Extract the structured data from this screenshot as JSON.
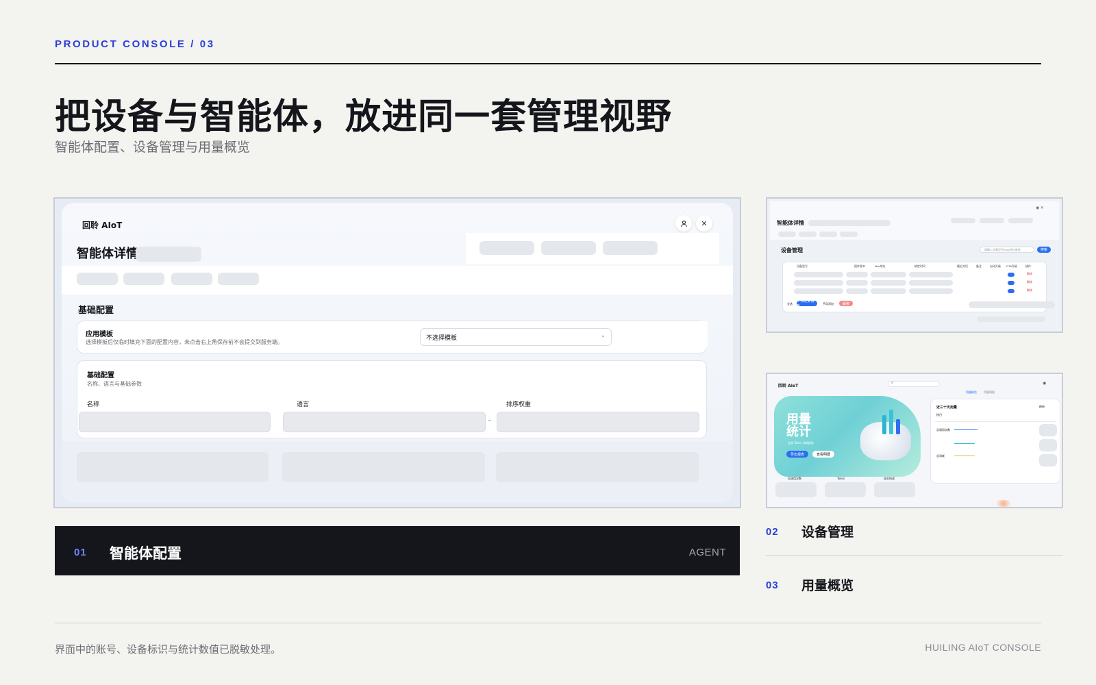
{
  "header": {
    "eyebrow": "PRODUCT CONSOLE / 03",
    "title": "把设备与智能体，放进同一套管理视野",
    "subtitle": "智能体配置、设备管理与用量概览"
  },
  "main_shot": {
    "logo": "回聆 AIoT",
    "page_title": "智能体详情",
    "section": "基础配置",
    "template_card": {
      "title": "应用模板",
      "desc": "选择模板后仅临时填充下面的配置内容，未点击右上角保存前不会提交到服务端。",
      "select_value": "不选择模板"
    },
    "basic_card": {
      "title": "基础配置",
      "desc": "名称、语言与基础参数",
      "fields": [
        "名称",
        "语言",
        "排序权重"
      ]
    },
    "icons": {
      "user": "user-icon",
      "close": "close-icon",
      "chevron": "chevron-down-icon"
    }
  },
  "device_shot": {
    "page_title": "智能体详情",
    "section": "设备管理",
    "search_placeholder": "请输入设备型号/Mac地址查询",
    "search_button": "搜索",
    "columns": [
      "设备型号",
      "固件版本",
      "Mac地址",
      "绑定时间",
      "最近对话",
      "备注",
      "自动升级",
      "OTA升级",
      "操作"
    ],
    "row_action": "解绑",
    "footer": [
      "全选",
      "+ 绑定新设备",
      "手动添加",
      "解绑"
    ]
  },
  "usage_shot": {
    "logo": "回聆 AIoT",
    "hero_title_1": "用量",
    "hero_title_2": "统计",
    "hero_sub": "全局 Token 消耗趋势",
    "hero_btn_1": "导出报表",
    "hero_btn_2": "查看明细",
    "tabs": [
      "用量概览",
      "用量明细"
    ],
    "panel_title": "近三十天用量",
    "panel_filter": "按日",
    "panel_refresh": "刷新",
    "panel_rows": [
      "总调用次数",
      "总消耗"
    ],
    "bottom_labels": [
      "总调用次数",
      "Token",
      "成本构成"
    ]
  },
  "captions": [
    {
      "num": "01",
      "title": "智能体配置",
      "tag": "AGENT"
    },
    {
      "num": "02",
      "title": "设备管理"
    },
    {
      "num": "03",
      "title": "用量概览"
    }
  ],
  "footer": {
    "note": "界面中的账号、设备标识与统计数值已脱敏处理。",
    "brand": "HUILING AIoT CONSOLE"
  },
  "colors": {
    "accent": "#2b3fd6",
    "dark": "#14161b",
    "background": "#f3f3ef"
  }
}
